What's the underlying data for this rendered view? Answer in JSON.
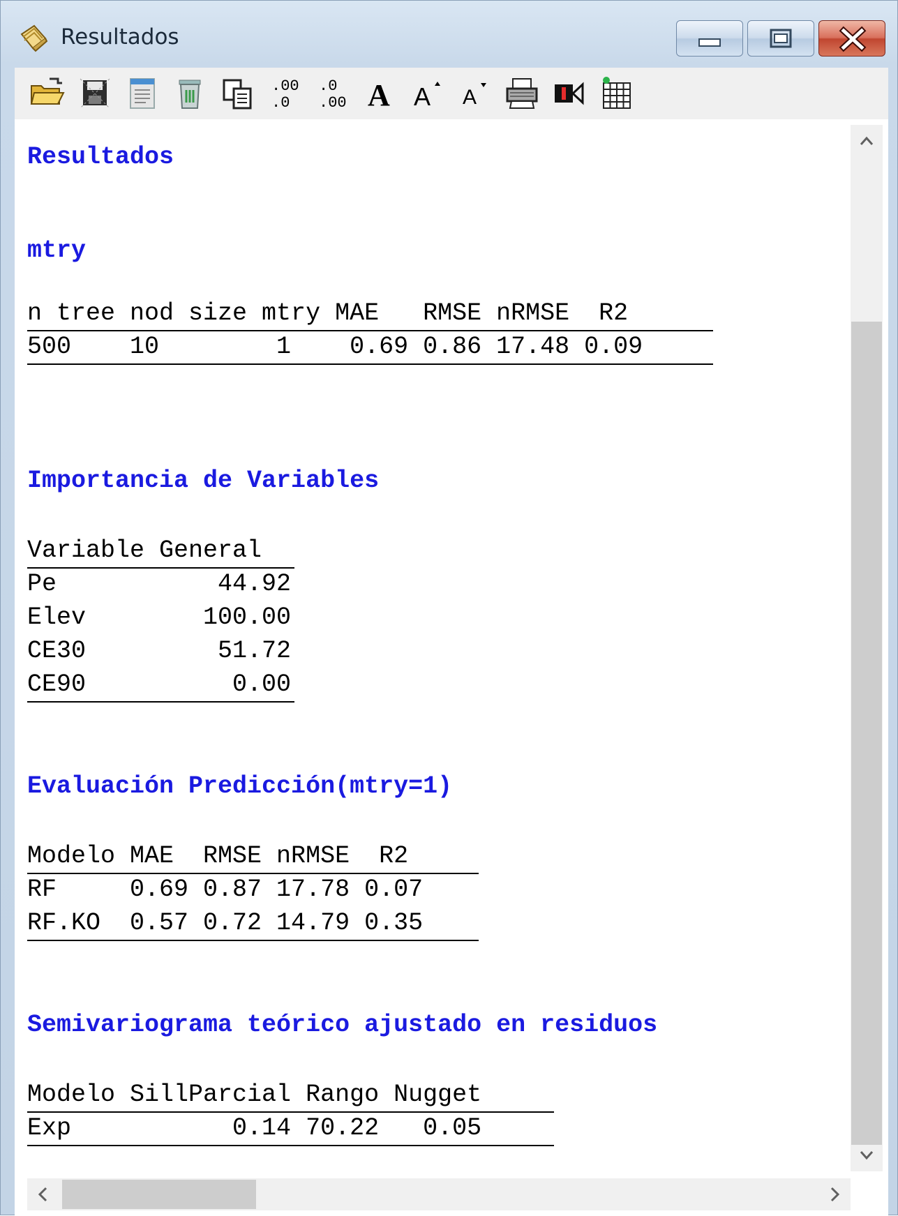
{
  "window": {
    "title": "Resultados",
    "icon": "notes-icon"
  },
  "toolbar": {
    "items": [
      {
        "name": "open-folder-icon"
      },
      {
        "name": "save-icon"
      },
      {
        "name": "document-icon"
      },
      {
        "name": "delete-icon"
      },
      {
        "name": "copy-icon"
      },
      {
        "name": "increase-decimals-icon",
        "label": ".00\n.0"
      },
      {
        "name": "decrease-decimals-icon",
        "label": ".0\n.00"
      },
      {
        "name": "bold-font-icon",
        "label": "A"
      },
      {
        "name": "increase-font-icon",
        "label": "A"
      },
      {
        "name": "decrease-font-icon",
        "label": "A"
      },
      {
        "name": "print-icon"
      },
      {
        "name": "video-icon"
      },
      {
        "name": "table-icon"
      }
    ]
  },
  "results": {
    "main_title": "Resultados",
    "mtry": {
      "heading": "mtry",
      "header": "n tree nod size mtry MAE   RMSE nRMSE  R2",
      "rows": [
        "500    10        1    0.69 0.86 17.48 0.09"
      ]
    },
    "importance": {
      "heading": "Importancia de Variables",
      "header": "Variable General",
      "rows": [
        "Pe           44.92",
        "Elev        100.00",
        "CE30         51.72",
        "CE90          0.00"
      ]
    },
    "evaluation": {
      "heading": "Evaluación Predicción(mtry=1)",
      "header": "Modelo MAE  RMSE nRMSE  R2",
      "rows": [
        "RF     0.69 0.87 17.78 0.07",
        "RF.KO  0.57 0.72 14.79 0.35"
      ]
    },
    "semivariogram": {
      "heading": "Semivariograma teórico ajustado en residuos",
      "header": "Modelo SillParcial Rango Nugget",
      "rows": [
        "Exp           0.14 70.22   0.05"
      ]
    }
  },
  "colors": {
    "heading": "#1a1ae0",
    "text": "#000000",
    "close_button": "#c04630"
  }
}
